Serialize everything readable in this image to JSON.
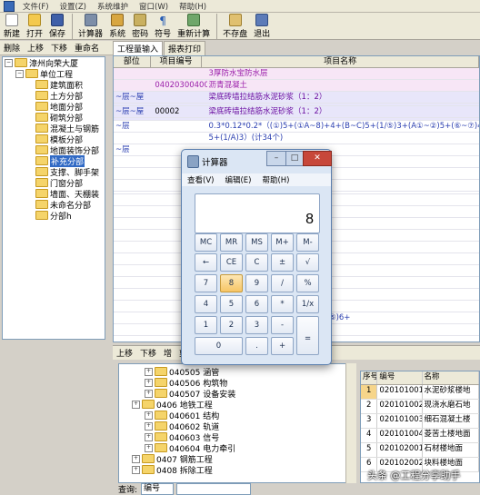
{
  "menubar": {
    "items": [
      "文件(F)",
      "设置(Z)",
      "系统维护",
      "窗口(W)",
      "帮助(H)"
    ]
  },
  "toolbar": {
    "buttons": [
      "新建",
      "打开",
      "保存",
      "计算器",
      "系统",
      "密码",
      "符号",
      "重新计算",
      "不存盘",
      "退出"
    ]
  },
  "left_tools": [
    "删除",
    "上移",
    "下移",
    "重命名"
  ],
  "tree": {
    "root": "漳州向荣大厦",
    "level1": "单位工程",
    "children": [
      "建筑面积",
      "土方分部",
      "地面分部",
      "砌筑分部",
      "混凝土与钢筋",
      "模板分部",
      "地面装饰分部",
      "补充分部",
      "支撑、脚手架",
      "门窗分部",
      "墙面、天棚装",
      "未命名分部",
      "分部h"
    ],
    "selected_index": 7
  },
  "tabs": [
    "工程量输入",
    "报表打印"
  ],
  "grid": {
    "headers": [
      "部位",
      "项目编号",
      "项目名称"
    ],
    "rows": [
      {
        "part": "",
        "code": "",
        "name": "3厚防水宝防水层"
      },
      {
        "part": "",
        "code": "040203004001",
        "name": "沥青混凝土"
      },
      {
        "part": "~层~屋",
        "code": "",
        "name": "梁底砖墙拉结筋水泥砂浆（1：2）"
      },
      {
        "part": "",
        "code": "",
        "name": ""
      },
      {
        "part": "~层~屋",
        "code": "00002",
        "name": "梁底砖墙拉结筋水泥砂浆（1：2）"
      },
      {
        "part": "",
        "code": "",
        "name": ""
      },
      {
        "part": "~层",
        "code": "",
        "name": "0.3*0.12*0.2*（(①)5+(①A~8)+4+(B~C)5+(1/⑤)3+(A①~②)5+(⑥~⑦)4+(⑤"
      },
      {
        "part": "",
        "code": "",
        "name": "5+(1/A)3）(计34个)"
      },
      {
        "part": "~层",
        "code": "",
        "name": ""
      },
      {
        "part": "",
        "code": "",
        "name": "⑥、C~⑦5) (计10个)"
      },
      {
        "part": "",
        "code": "",
        "name": "~⑦3) (计16个)"
      },
      {
        "part": "",
        "code": "",
        "name": "(计7个)"
      },
      {
        "part": "",
        "code": "",
        "name": ""
      },
      {
        "part": "",
        "code": "",
        "name": "⑥、C~⑦5) (计10个)"
      },
      {
        "part": "",
        "code": "",
        "name": "C)3+5*2) (计16个)"
      },
      {
        "part": "",
        "code": "",
        "name": "C)3+5*2) (计16个)"
      },
      {
        "part": "",
        "code": "",
        "name": "⑤6) (计10个)"
      },
      {
        "part": "",
        "code": "",
        "name": "C~⑦5) (计10个)"
      },
      {
        "part": "",
        "code": "",
        "name": "(计18个)"
      },
      {
        "part": "",
        "code": "",
        "name": "(计18个)"
      },
      {
        "part": "",
        "code": "",
        "name": "(计18个)"
      },
      {
        "part": "",
        "code": "",
        "name": "(计18个)"
      },
      {
        "part": "",
        "code": "",
        "name": "(计18个)"
      },
      {
        "part": "",
        "code": "",
        "name": "5) +0.3*0.12*0.2*（(1/①)6+(1/⑤)6+"
      },
      {
        "part": "",
        "code": "",
        "name": "(计18个)"
      }
    ]
  },
  "bottom_bar": [
    "上移",
    "下移",
    "增",
    "剪项目",
    "粘贴项目",
    "剪切项目",
    "全部展开"
  ],
  "bottom_tree": [
    {
      "indent": 2,
      "label": "040505 涵管"
    },
    {
      "indent": 2,
      "label": "040506 构筑物"
    },
    {
      "indent": 2,
      "label": "040507 设备安装"
    },
    {
      "indent": 1,
      "label": "0406 地铁工程"
    },
    {
      "indent": 2,
      "label": "040601 结构"
    },
    {
      "indent": 2,
      "label": "040602 轨道"
    },
    {
      "indent": 2,
      "label": "040603 信号"
    },
    {
      "indent": 2,
      "label": "040604 电力牵引"
    },
    {
      "indent": 1,
      "label": "0407 钢筋工程"
    },
    {
      "indent": 1,
      "label": "0408 拆除工程"
    }
  ],
  "bottom_table": {
    "headers": [
      "序号",
      "编号",
      "名称"
    ],
    "rows": [
      {
        "no": "1",
        "code": "020101001",
        "name": "水泥砂浆楼地"
      },
      {
        "no": "2",
        "code": "020101002",
        "name": "现浇水磨石地"
      },
      {
        "no": "3",
        "code": "020101003",
        "name": "细石混凝土楼"
      },
      {
        "no": "4",
        "code": "020101004",
        "name": "菱苦土楼地面"
      },
      {
        "no": "5",
        "code": "020102001",
        "name": "石材楼地面"
      },
      {
        "no": "6",
        "code": "020102002",
        "name": "块料楼地面"
      }
    ]
  },
  "search": {
    "label": "查询:",
    "value": "编号"
  },
  "calculator": {
    "title": "计算器",
    "menu": [
      "查看(V)",
      "编辑(E)",
      "帮助(H)"
    ],
    "display": "8",
    "keys": [
      "MC",
      "MR",
      "MS",
      "M+",
      "M-",
      "←",
      "CE",
      "C",
      "±",
      "√",
      "7",
      "8",
      "9",
      "/",
      "%",
      "4",
      "5",
      "6",
      "*",
      "1/x",
      "1",
      "2",
      "3",
      "-",
      "=",
      "0",
      ".",
      "+"
    ],
    "active_key": "8"
  },
  "watermark": "头条 @工程分享助手"
}
